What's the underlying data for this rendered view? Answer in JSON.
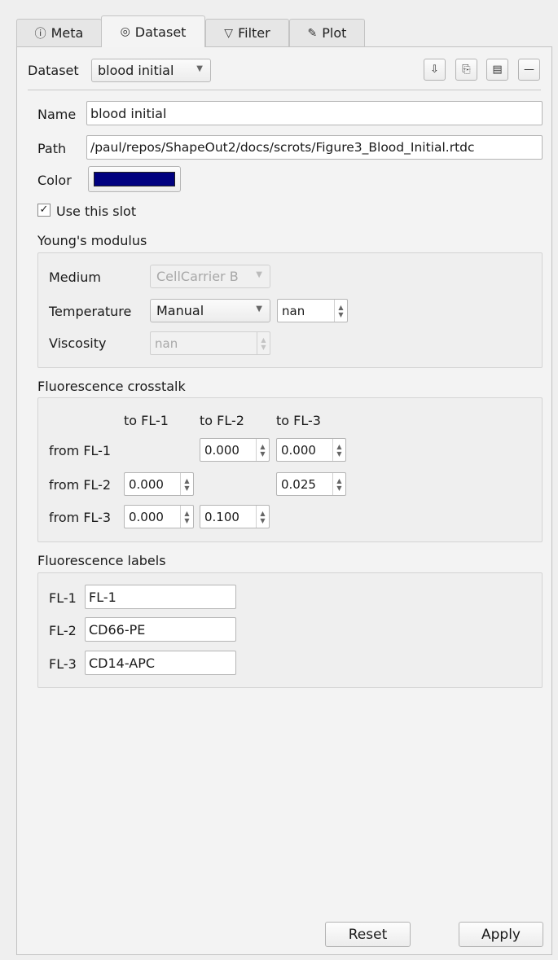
{
  "tabs": [
    {
      "label": "Meta",
      "icon": "info-icon",
      "glyph": "ⓘ"
    },
    {
      "label": "Dataset",
      "icon": "dataset-icon",
      "glyph": "◎"
    },
    {
      "label": "Filter",
      "icon": "filter-icon",
      "glyph": "▽"
    },
    {
      "label": "Plot",
      "icon": "plot-icon",
      "glyph": "✎"
    }
  ],
  "dataset_bar": {
    "label": "Dataset",
    "selected": "blood initial",
    "buttons": [
      {
        "icon": "sort-icon",
        "glyph": "⇩"
      },
      {
        "icon": "duplicate-icon",
        "glyph": "⎘"
      },
      {
        "icon": "clipboard-icon",
        "glyph": "▤"
      },
      {
        "icon": "remove-icon",
        "glyph": "—"
      }
    ]
  },
  "general": {
    "name_label": "Name",
    "name_value": "blood initial",
    "path_label": "Path",
    "path_value": "/paul/repos/ShapeOut2/docs/scrots/Figure3_Blood_Initial.rtdc",
    "color_label": "Color",
    "color_value": "#00007f",
    "use_slot_label": "Use this slot",
    "use_slot_checked": true,
    "check_glyph": "✓"
  },
  "youngs": {
    "title": "Young's modulus",
    "medium_label": "Medium",
    "medium_value": "CellCarrier B",
    "temperature_label": "Temperature",
    "temperature_mode": "Manual",
    "temperature_value": "nan",
    "viscosity_label": "Viscosity",
    "viscosity_value": "nan"
  },
  "crosstalk": {
    "title": "Fluorescence crosstalk",
    "columns": [
      "to FL-1",
      "to FL-2",
      "to FL-3"
    ],
    "rows": [
      {
        "label": "from FL-1",
        "values": [
          null,
          "0.000",
          "0.000"
        ]
      },
      {
        "label": "from FL-2",
        "values": [
          "0.000",
          null,
          "0.025"
        ]
      },
      {
        "label": "from FL-3",
        "values": [
          "0.000",
          "0.100",
          null
        ]
      }
    ]
  },
  "labels": {
    "title": "Fluorescence labels",
    "items": [
      {
        "key": "FL-1",
        "value": "FL-1"
      },
      {
        "key": "FL-2",
        "value": "CD66-PE"
      },
      {
        "key": "FL-3",
        "value": "CD14-APC"
      }
    ]
  },
  "footer": {
    "reset_label": "Reset",
    "apply_label": "Apply"
  },
  "spin_glyphs": {
    "up": "▲",
    "down": "▼"
  },
  "combo_arrow": "▼"
}
